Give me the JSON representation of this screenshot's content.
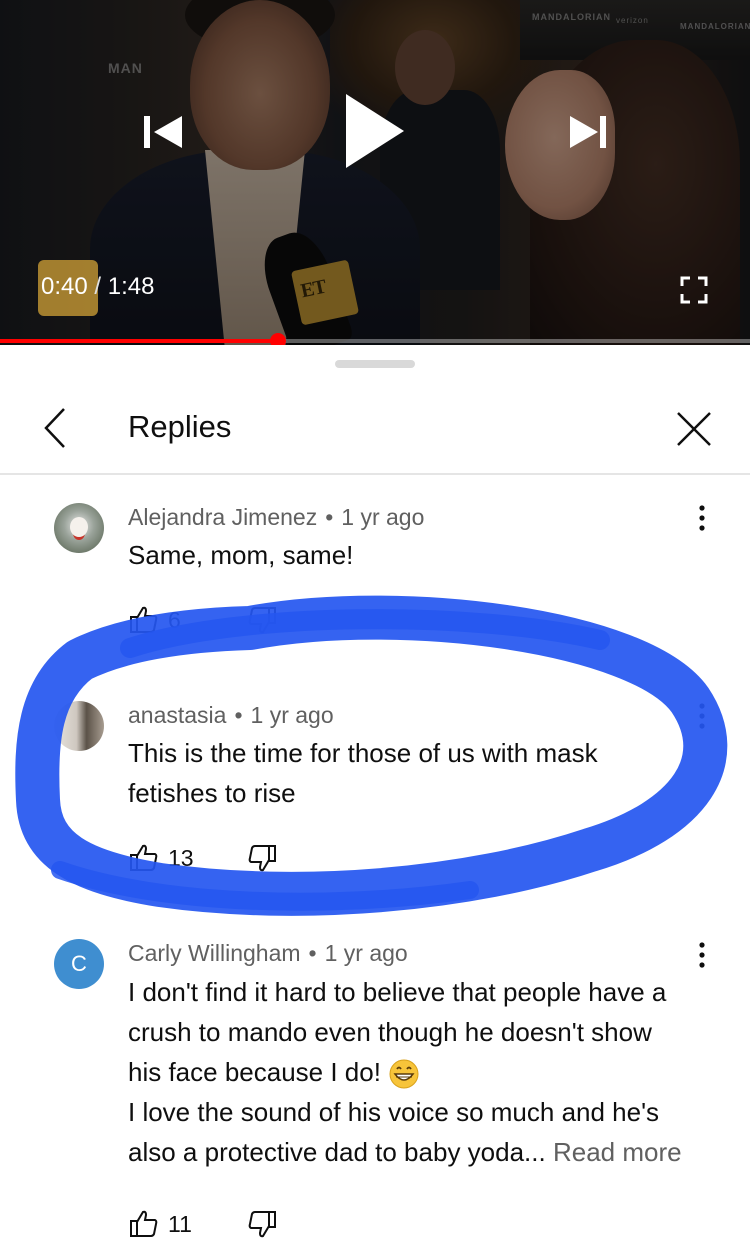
{
  "player": {
    "background_text": [
      "MAN",
      "MANDALORIAN",
      "verizon",
      "MANDALORIAN"
    ],
    "logo_text": "ET",
    "current_time": "0:40",
    "separator": "/",
    "duration": "1:48",
    "progress_fraction": 0.37,
    "icons": {
      "previous": "skip-previous-icon",
      "play": "play-icon",
      "next": "skip-next-icon",
      "fullscreen": "fullscreen-icon"
    },
    "progress_color": "#ff0000"
  },
  "panel": {
    "title": "Replies",
    "back_icon": "chevron-left-icon",
    "close_icon": "close-icon"
  },
  "comments": [
    {
      "author": "Alejandra Jimenez",
      "dot": "•",
      "age": "1 yr ago",
      "text": "Same, mom, same!",
      "likes": "6",
      "avatar": "photo"
    },
    {
      "author": "anastasia",
      "dot": "•",
      "age": "1 yr ago",
      "text_line1": "This is the time for those of us with mask",
      "text_line2": "fetishes to rise",
      "likes": "13",
      "avatar": "photo"
    },
    {
      "author": "Carly Willingham",
      "dot": "•",
      "age": "1 yr ago",
      "avatar_initial": "C",
      "avatar_color": "#3f8ed0",
      "text_line1": "I don't find it hard to believe that people have a",
      "text_line2": "crush to mando even though he doesn't show",
      "text_line3": "his face because I do!",
      "emoji": "grinning-face-icon",
      "text_line4": "I love the sound of his voice so much and he's",
      "text_line5": "also a protective dad to baby yoda...",
      "read_more": "Read more",
      "likes": "11"
    }
  ],
  "annotation": {
    "type": "hand-drawn ellipse",
    "color": "#2456f0",
    "encircles": "anastasia comment"
  }
}
